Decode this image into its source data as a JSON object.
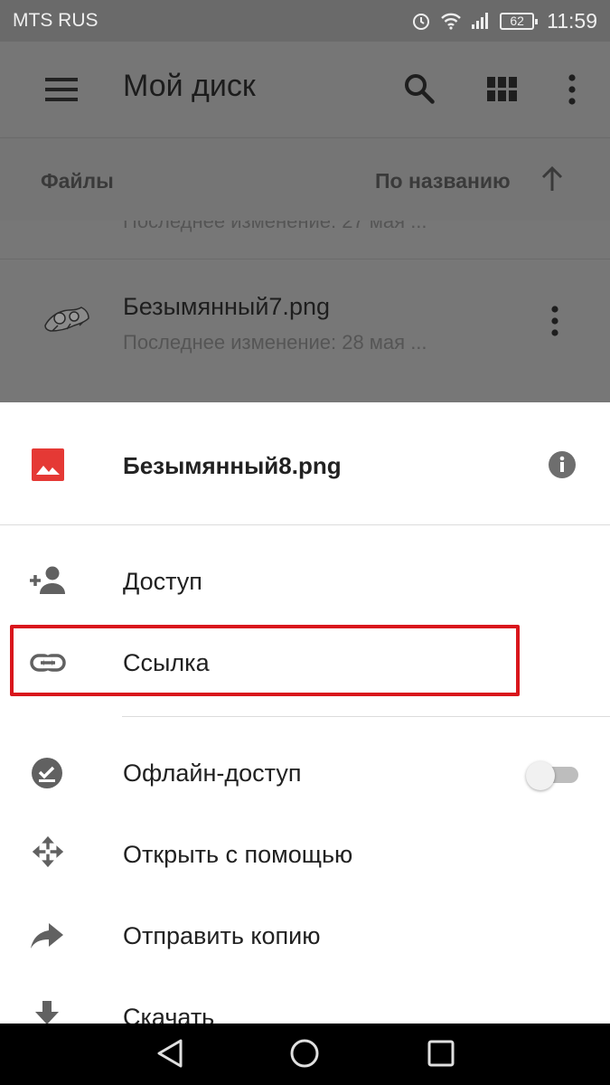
{
  "status_bar": {
    "carrier": "MTS RUS",
    "battery": "62",
    "time": "11:59",
    "icons": [
      "alarm-icon",
      "wifi-icon",
      "signal-icon",
      "battery-icon"
    ]
  },
  "app_bar": {
    "title": "Мой диск",
    "icons": [
      "menu-icon",
      "search-icon",
      "grid-view-icon",
      "more-vert-icon"
    ]
  },
  "sort_bar": {
    "section_label": "Файлы",
    "sort_label": "По названию",
    "sort_icon": "arrow-up-icon"
  },
  "file_list": {
    "previous_item_subtitle": "Последнее изменение: 27 мая ...",
    "item": {
      "name": "Безымянный7.png",
      "subtitle": "Последнее изменение: 28 мая ..."
    }
  },
  "sheet": {
    "file_name": "Безымянный8.png",
    "items": [
      {
        "label": "Доступ",
        "icon": "person-add-icon"
      },
      {
        "label": "Ссылка",
        "icon": "link-icon"
      },
      {
        "label": "Офлайн-доступ",
        "icon": "offline-pin-icon",
        "toggle_on": false
      },
      {
        "label": "Открыть с помощью",
        "icon": "open-with-icon"
      },
      {
        "label": "Отправить копию",
        "icon": "share-arrow-icon"
      },
      {
        "label": "Скачать",
        "icon": "download-icon"
      }
    ]
  },
  "colors": {
    "highlight_border": "#d9161c",
    "image_icon_red": "#e53935",
    "scrim": "#767676"
  }
}
